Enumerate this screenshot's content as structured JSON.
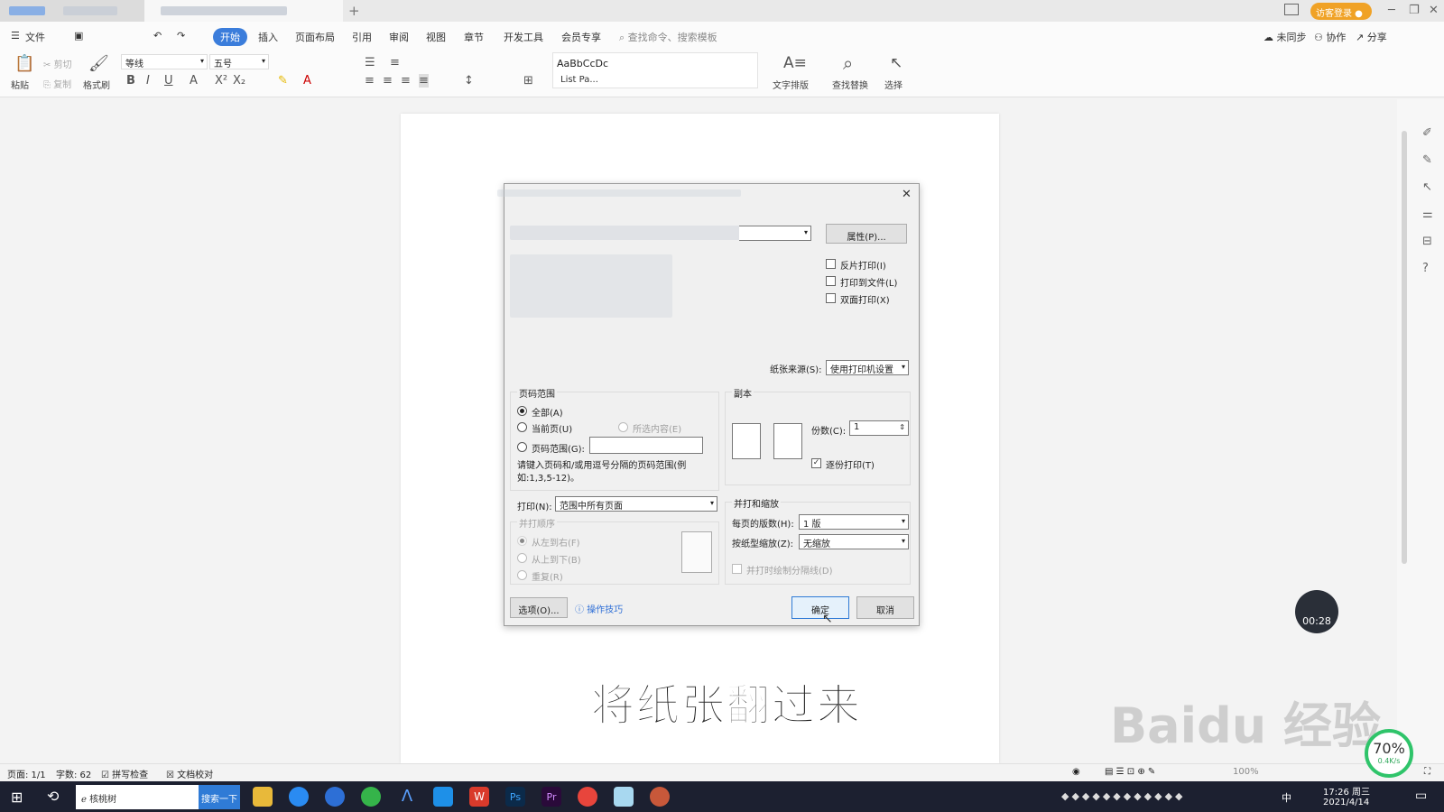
{
  "window": {
    "visitor_label": "访客登录"
  },
  "menubar": {
    "file": "文件",
    "items": [
      "开始",
      "插入",
      "页面布局",
      "引用",
      "审阅",
      "视图",
      "章节",
      "开发工具",
      "会员专享"
    ],
    "search": "查找命令、搜索模板",
    "sync": "未同步",
    "collab": "协作",
    "share": "分享"
  },
  "ribbon": {
    "paste": "粘贴",
    "cut": "剪切",
    "copy": "复制",
    "format_painter": "格式刷",
    "font_name": "等线",
    "font_size": "五号",
    "style_preview": "AaBbCcDc",
    "style_name": "List Pa...",
    "text_layout": "文字排版",
    "find_replace": "查找替换",
    "select": "选择"
  },
  "dialog": {
    "properties_button": "属性(P)...",
    "reverse_print": "反片打印(I)",
    "print_to_file": "打印到文件(L)",
    "duplex_print": "双面打印(X)",
    "paper_source_label": "纸张来源(S):",
    "paper_source_value": "使用打印机设置",
    "page_range": {
      "title": "页码范围",
      "all": "全部(A)",
      "current": "当前页(U)",
      "selection": "所选内容(E)",
      "range": "页码范围(G):",
      "hint": "请键入页码和/或用逗号分隔的页码范围(例如:1,3,5-12)。"
    },
    "print_label": "打印(N):",
    "print_value": "范围中所有页面",
    "order": {
      "title": "并打顺序",
      "lr": "从左到右(F)",
      "tb": "从上到下(B)",
      "repeat": "重复(R)"
    },
    "copies": {
      "title": "副本",
      "count_label": "份数(C):",
      "count_value": "1",
      "collate": "逐份打印(T)"
    },
    "zoom": {
      "title": "并打和缩放",
      "per_page_label": "每页的版数(H):",
      "per_page_value": "1 版",
      "scale_label": "按纸型缩放(Z):",
      "scale_value": "无缩放",
      "draw_lines": "并打时绘制分隔线(D)"
    },
    "options_button": "选项(O)...",
    "tips_link": "操作技巧",
    "ok_button": "确定",
    "cancel_button": "取消"
  },
  "overlay": {
    "subtitle": "将纸张翻过来",
    "timer": "00:28",
    "watermark": "Baidu 经验",
    "net_percent": "70%",
    "net_speed": "0.4K/s"
  },
  "statusbar": {
    "page": "页面: 1/1",
    "words": "字数: 62",
    "spell": "拼写检查",
    "proof": "文档校对",
    "zoom": "100%"
  },
  "taskbar": {
    "browser_tab": "核桃树",
    "search_button": "搜索一下",
    "time": "17:26 周三",
    "date": "2021/4/14",
    "ime": "中"
  }
}
